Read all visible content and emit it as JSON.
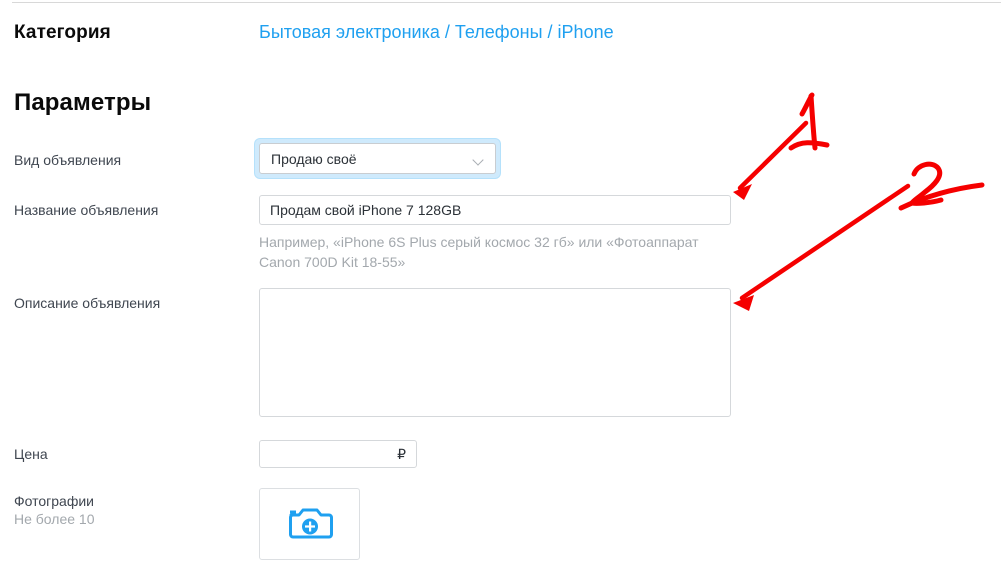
{
  "page": {
    "category_label": "Категория",
    "params_heading": "Параметры"
  },
  "breadcrumb": {
    "items": [
      "Бытовая электроника",
      "Телефоны",
      "iPhone"
    ],
    "separator": "/",
    "link_color": "#1fa0f0"
  },
  "form": {
    "ad_type": {
      "label": "Вид объявления",
      "value": "Продаю своё",
      "chevron_icon": "chevron-down-icon",
      "focused": true,
      "focus_color": "#cfeafc"
    },
    "ad_title": {
      "label": "Название объявления",
      "value": "Продам свой iPhone 7 128GB",
      "placeholder": "",
      "hint": "Например, «iPhone 6S Plus серый космос 32 гб» или «Фотоаппарат Canon 700D Kit 18-55»"
    },
    "ad_description": {
      "label": "Описание объявления",
      "value": "",
      "placeholder": ""
    },
    "price": {
      "label": "Цена",
      "value": "",
      "placeholder": "",
      "currency_symbol": "₽"
    },
    "photos": {
      "label": "Фотографии",
      "sublabel": "Не более 10",
      "upload_icon": "camera-add-icon",
      "icon_color": "#1fa0f0"
    }
  },
  "annotations": {
    "color": "#f50000",
    "marks": [
      {
        "number": "1",
        "points_to": "ad-title-input"
      },
      {
        "number": "2",
        "points_to": "ad-description-textarea"
      }
    ]
  }
}
